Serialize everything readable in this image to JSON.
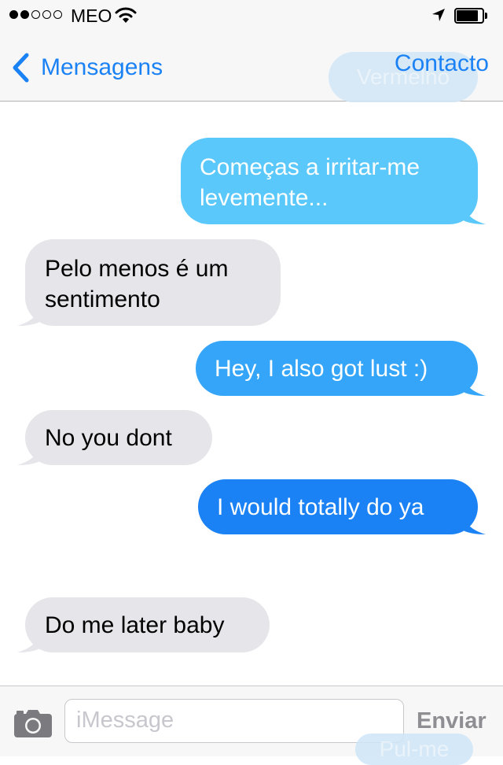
{
  "status_bar": {
    "carrier": "MEO",
    "signal_bars_filled": 2,
    "signal_bars_total": 5,
    "wifi_icon": "wifi-icon",
    "location_icon": "location-arrow-icon",
    "battery_level": 0.85
  },
  "nav": {
    "back_label": "Mensagens",
    "back_icon": "chevron-left-icon",
    "contact_label": "Contacto",
    "ghost_top_text": "Vermelho"
  },
  "messages": [
    {
      "direction": "outgoing",
      "text_lines": [
        "Começas a irritar-me",
        "levemente..."
      ],
      "color": "#5ac8fa"
    },
    {
      "direction": "incoming",
      "text_lines": [
        "Pelo menos é um",
        "sentimento"
      ],
      "color": "#e5e5ea"
    },
    {
      "direction": "outgoing",
      "text_lines": [
        "Hey, I also got lust :)"
      ],
      "color": "#34a5f8"
    },
    {
      "direction": "incoming",
      "text_lines": [
        "No you dont"
      ],
      "color": "#e5e5ea"
    },
    {
      "direction": "outgoing",
      "text_lines": [
        "I would totally do ya"
      ],
      "color": "#1b82f5"
    },
    {
      "direction": "incoming",
      "text_lines": [
        "Do me later baby"
      ],
      "color": "#e5e5ea"
    }
  ],
  "input": {
    "camera_icon": "camera-icon",
    "placeholder": "iMessage",
    "send_label": "Enviar",
    "ghost_bottom_text": "Pul-me"
  },
  "colors": {
    "accent": "#1b82f5",
    "bar_background": "#f7f7f7",
    "incoming_bubble": "#e5e5ea"
  }
}
